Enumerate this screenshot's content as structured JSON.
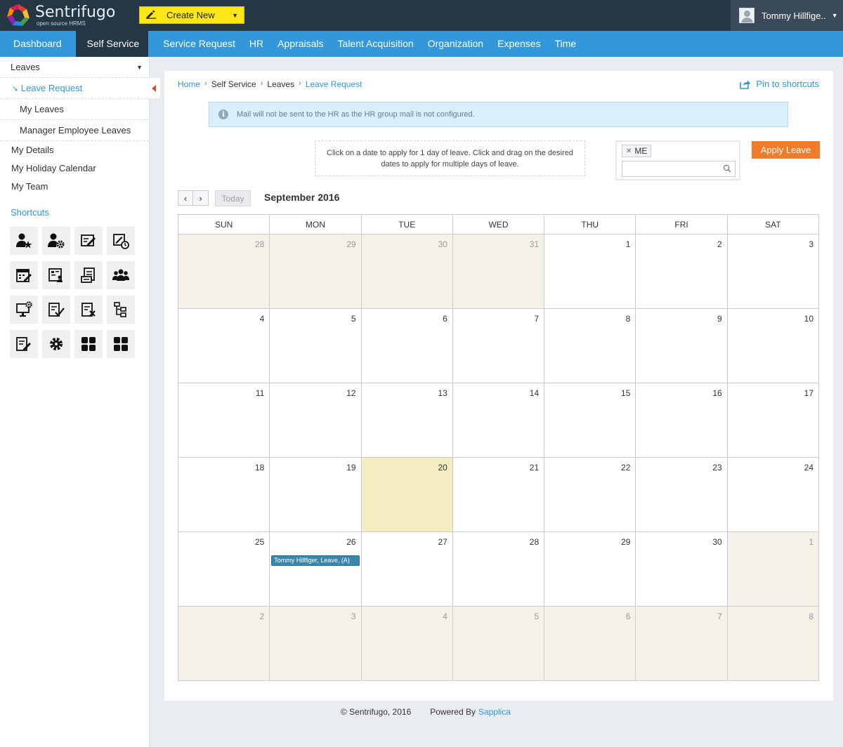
{
  "brand": {
    "title": "Sentrifugo",
    "subtitle": "open source HRMS"
  },
  "topbar": {
    "create_new": "Create New",
    "user_name": "Tommy Hillfige.."
  },
  "nav": {
    "items": [
      "Dashboard",
      "Self Service",
      "Service Request",
      "HR",
      "Appraisals",
      "Talent Acquisition",
      "Organization",
      "Expenses",
      "Time"
    ],
    "active": "Self Service"
  },
  "sidebar": {
    "section": "Leaves",
    "sub_items": [
      "Leave Request",
      "My Leaves",
      "Manager Employee Leaves"
    ],
    "links": [
      "My Details",
      "My Holiday Calendar",
      "My Team"
    ],
    "shortcuts_title": "Shortcuts",
    "shortcut_icons": [
      "user-star-icon",
      "user-gear-icon",
      "edit-ticket-icon",
      "ticket-clock-icon",
      "calendar-edit-icon",
      "id-card-icon",
      "document-user-icon",
      "team-icon",
      "monitor-gear-icon",
      "document-check-icon",
      "document-cancel-icon",
      "hierarchy-icon",
      "document-edit-icon",
      "gear-icon",
      "grid-icon",
      "grid-icon"
    ]
  },
  "breadcrumb": {
    "home": "Home",
    "self_service": "Self Service",
    "leaves": "Leaves",
    "current": "Leave Request"
  },
  "pin_label": "Pin to shortcuts",
  "info_message": "Mail will not be sent to the HR as the HR group mail is not configured.",
  "hint": "Click on a date to apply for 1 day of leave. Click and drag on the desired dates to apply for multiple days of leave.",
  "filter": {
    "tag": "ME",
    "search_value": ""
  },
  "apply_button": "Apply Leave",
  "calendar": {
    "today_label": "Today",
    "month_title": "September 2016",
    "weekdays": [
      "SUN",
      "MON",
      "TUE",
      "WED",
      "THU",
      "FRI",
      "SAT"
    ],
    "weeks": [
      [
        {
          "d": "28",
          "o": true
        },
        {
          "d": "29",
          "o": true
        },
        {
          "d": "30",
          "o": true
        },
        {
          "d": "31",
          "o": true
        },
        {
          "d": "1"
        },
        {
          "d": "2"
        },
        {
          "d": "3"
        }
      ],
      [
        {
          "d": "4"
        },
        {
          "d": "5"
        },
        {
          "d": "6"
        },
        {
          "d": "7"
        },
        {
          "d": "8"
        },
        {
          "d": "9"
        },
        {
          "d": "10"
        }
      ],
      [
        {
          "d": "11"
        },
        {
          "d": "12"
        },
        {
          "d": "13"
        },
        {
          "d": "14"
        },
        {
          "d": "15"
        },
        {
          "d": "16"
        },
        {
          "d": "17"
        }
      ],
      [
        {
          "d": "18"
        },
        {
          "d": "19"
        },
        {
          "d": "20",
          "t": true
        },
        {
          "d": "21"
        },
        {
          "d": "22"
        },
        {
          "d": "23"
        },
        {
          "d": "24"
        }
      ],
      [
        {
          "d": "25"
        },
        {
          "d": "26",
          "e": "Tommy Hillfiger, Leave, (A)"
        },
        {
          "d": "27"
        },
        {
          "d": "28"
        },
        {
          "d": "29"
        },
        {
          "d": "30"
        },
        {
          "d": "1",
          "o": true
        }
      ],
      [
        {
          "d": "2",
          "o": true
        },
        {
          "d": "3",
          "o": true
        },
        {
          "d": "4",
          "o": true
        },
        {
          "d": "5",
          "o": true
        },
        {
          "d": "6",
          "o": true
        },
        {
          "d": "7",
          "o": true
        },
        {
          "d": "8",
          "o": true
        }
      ]
    ]
  },
  "footer": {
    "copyright": "© Sentrifugo, 2016",
    "powered": "Powered By",
    "powered_link": "Sapplica"
  },
  "colors": {
    "topbar": "#253645",
    "nav": "#3297db",
    "accent": "#f07c2b",
    "create": "#fce615",
    "today": "#f5edc2",
    "other_month": "#f3f1e8",
    "event": "#3a87ad"
  }
}
